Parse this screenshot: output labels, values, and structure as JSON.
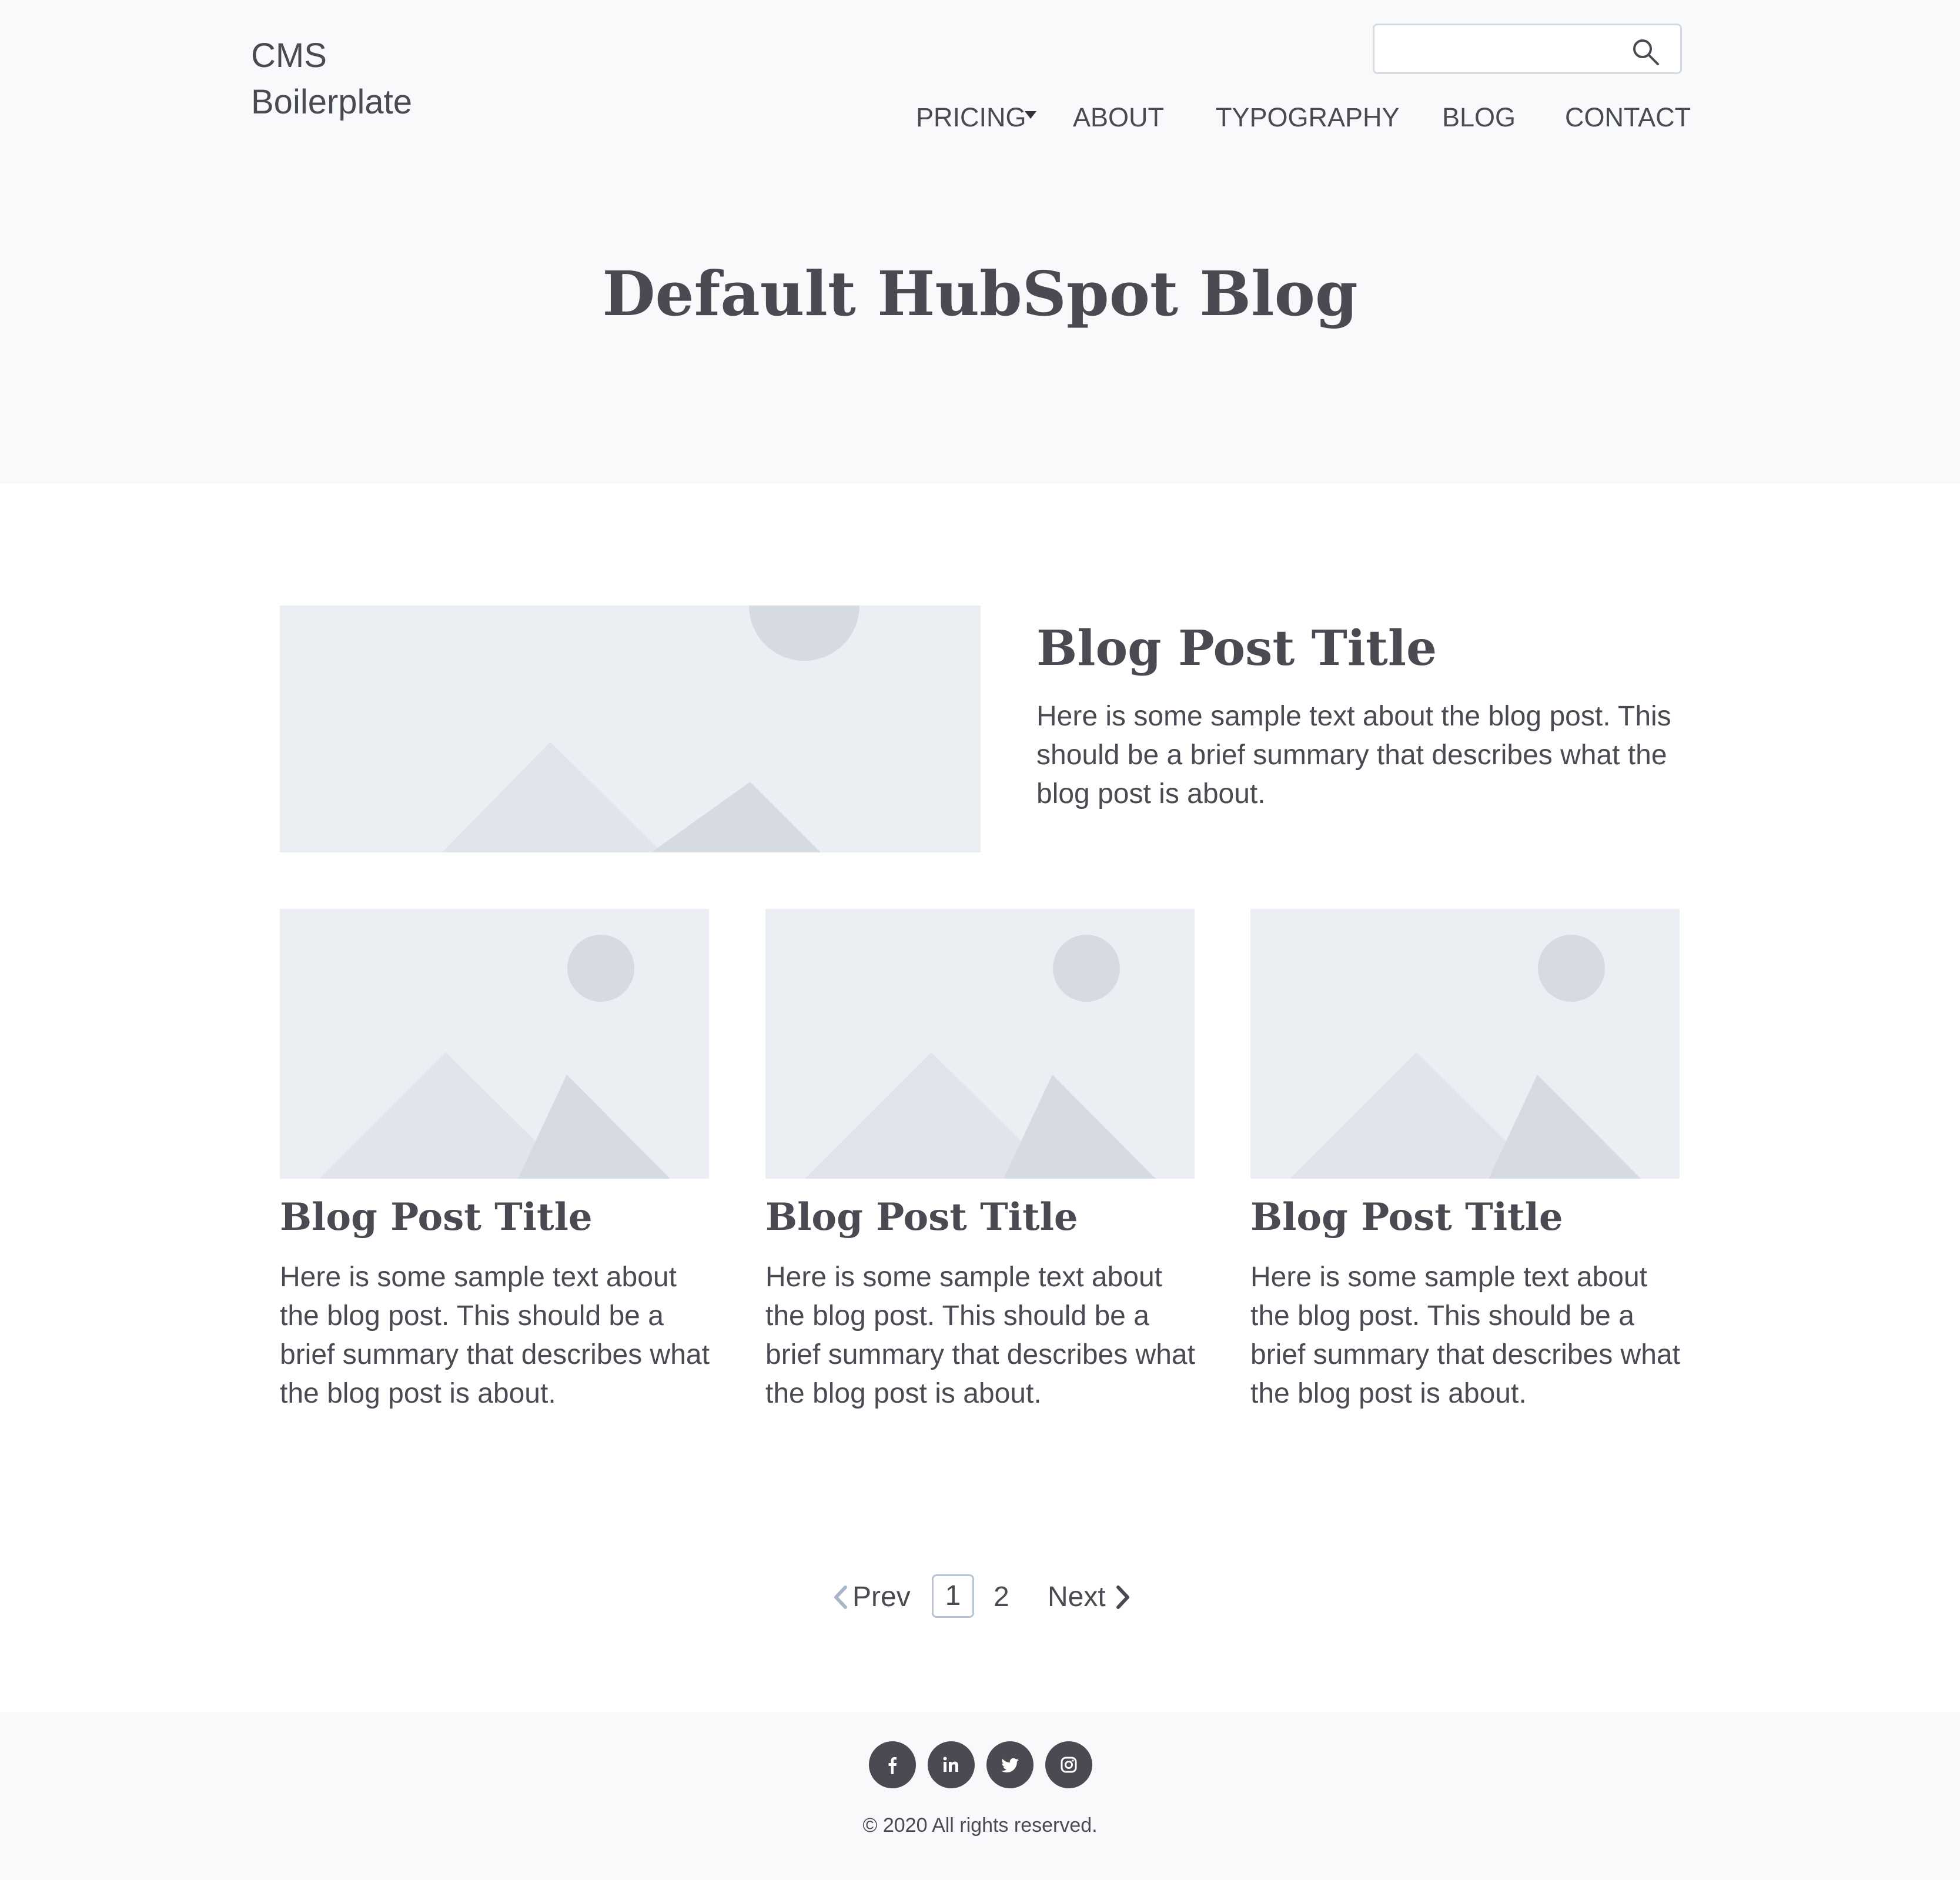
{
  "header": {
    "logo": "CMS\nBoilerplate",
    "search": {
      "value": "",
      "placeholder": ""
    },
    "nav": [
      {
        "label": "PRICING",
        "has_dropdown": true
      },
      {
        "label": "ABOUT"
      },
      {
        "label": "TYPOGRAPHY"
      },
      {
        "label": "BLOG"
      },
      {
        "label": "CONTACT"
      }
    ]
  },
  "hero": {
    "title": "Default HubSpot Blog"
  },
  "featured_post": {
    "title": "Blog Post Title",
    "summary": "Here is some sample text about the blog post. This should be a brief summary that describes what the blog post is about."
  },
  "posts": [
    {
      "title": "Blog Post Title",
      "summary": "Here is some sample text about the blog post. This should be a brief summary that describes what the blog post is about."
    },
    {
      "title": "Blog Post Title",
      "summary": "Here is some sample text about the blog post. This should be a brief summary that describes what the blog post is about."
    },
    {
      "title": "Blog Post Title",
      "summary": "Here is some sample text about the blog post. This should be a brief summary that describes what the blog post is about."
    }
  ],
  "pagination": {
    "prev": "Prev",
    "pages": [
      "1",
      "2"
    ],
    "current": "1",
    "next": "Next"
  },
  "footer": {
    "social": [
      "facebook-icon",
      "linkedin-icon",
      "twitter-icon",
      "instagram-icon"
    ],
    "copyright": "© 2020 All rights reserved."
  },
  "colors": {
    "text": "#494a52",
    "header_background": "#f8f9fb",
    "placeholder_background": "#ebeef3",
    "placeholder_shape_light": "#e1e5eb",
    "placeholder_shape_dark": "#d6dbe3",
    "social_background": "#4a4b52"
  }
}
